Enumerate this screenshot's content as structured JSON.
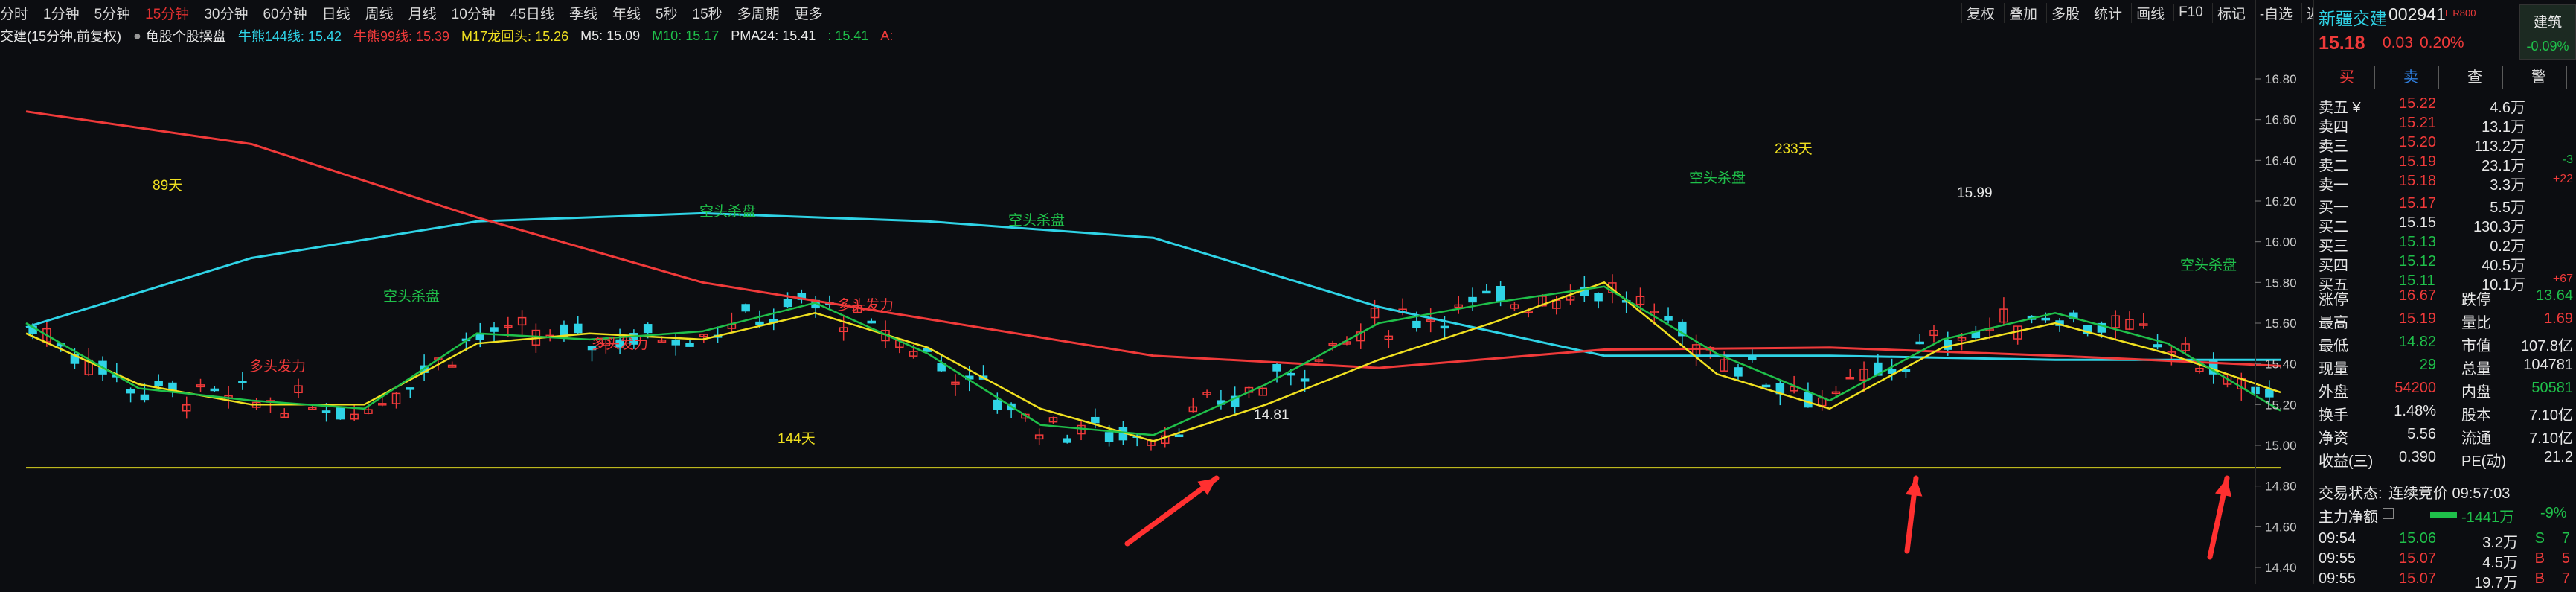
{
  "periods": [
    "分时",
    "1分钟",
    "5分钟",
    "15分钟",
    "30分钟",
    "60分钟",
    "日线",
    "周线",
    "月线",
    "10分钟",
    "45日线",
    "季线",
    "年线",
    "5秒",
    "15秒",
    "多周期",
    "更多"
  ],
  "active_period": "15分钟",
  "tools": [
    "复权",
    "叠加",
    "多股",
    "统计",
    "画线",
    "F10",
    "标记",
    "-自选",
    "返回"
  ],
  "indicator": {
    "title": "交建(15分钟,前复权)",
    "name": "龟股个股操盘",
    "items": [
      {
        "label": "牛熊144线: 15.42",
        "color": "#2fd3e6"
      },
      {
        "label": "牛熊99线: 15.39",
        "color": "#f03a3a"
      },
      {
        "label": "M17龙回头: 15.26",
        "color": "#f0e020"
      },
      {
        "label": "M5: 15.09",
        "color": "#e8e8e8"
      },
      {
        "label": "M10: 15.17",
        "color": "#1fc04a"
      },
      {
        "label": "PMA24: 15.41",
        "color": "#e8e8e8"
      },
      {
        "label": ": 15.41",
        "color": "#1fc04a"
      },
      {
        "label": "A:",
        "color": "#f03a3a"
      }
    ]
  },
  "chart_data": {
    "type": "line",
    "ylim": [
      14.4,
      16.9
    ],
    "yticks": [
      16.8,
      16.6,
      16.4,
      16.2,
      16.0,
      15.8,
      15.6,
      15.4,
      15.2,
      15.0,
      14.8,
      14.6,
      14.4
    ],
    "horizontal_line": 14.89,
    "annotations": [
      {
        "text": "89天",
        "color": "#f0e020"
      },
      {
        "text": "233天",
        "color": "#f0e020"
      },
      {
        "text": "144天",
        "color": "#f0e020"
      },
      {
        "text": "空头杀盘",
        "color": "#1fc04a"
      },
      {
        "text": "空头杀盘",
        "color": "#1fc04a"
      },
      {
        "text": "空头杀盘",
        "color": "#1fc04a"
      },
      {
        "text": "空头杀盘",
        "color": "#1fc04a"
      },
      {
        "text": "空头杀盘",
        "color": "#1fc04a"
      },
      {
        "text": "多头发力",
        "color": "#f03a3a"
      },
      {
        "text": "多头发力",
        "color": "#f03a3a"
      },
      {
        "text": "多头发力",
        "color": "#f03a3a"
      },
      {
        "text": "14.81",
        "color": "#e8e8e8"
      },
      {
        "text": "15.99",
        "color": "#e8e8e8"
      }
    ],
    "series": [
      {
        "name": "牛熊144线",
        "color": "#2fd3e6",
        "x": [
          0,
          10,
          20,
          30,
          40,
          50,
          60,
          70,
          80,
          90,
          100
        ],
        "values": [
          15.58,
          15.92,
          16.1,
          16.14,
          16.1,
          16.02,
          15.68,
          15.44,
          15.44,
          15.42,
          15.42
        ]
      },
      {
        "name": "牛熊99线",
        "color": "#f03a3a",
        "x": [
          0,
          10,
          20,
          30,
          40,
          50,
          60,
          70,
          80,
          90,
          100
        ],
        "values": [
          16.64,
          16.48,
          16.12,
          15.8,
          15.62,
          15.44,
          15.38,
          15.47,
          15.48,
          15.44,
          15.39
        ]
      },
      {
        "name": "M17龙回头",
        "color": "#f0e020",
        "x": [
          0,
          5,
          10,
          15,
          20,
          25,
          30,
          35,
          40,
          45,
          50,
          55,
          60,
          65,
          70,
          75,
          80,
          85,
          90,
          95,
          100
        ],
        "values": [
          15.55,
          15.3,
          15.2,
          15.2,
          15.5,
          15.55,
          15.52,
          15.65,
          15.48,
          15.18,
          15.02,
          15.2,
          15.42,
          15.6,
          15.8,
          15.35,
          15.18,
          15.48,
          15.6,
          15.45,
          15.26
        ]
      },
      {
        "name": "M10",
        "color": "#1fc04a",
        "x": [
          0,
          5,
          10,
          15,
          20,
          25,
          30,
          35,
          40,
          45,
          50,
          55,
          60,
          65,
          70,
          75,
          80,
          85,
          90,
          95,
          100
        ],
        "values": [
          15.6,
          15.28,
          15.22,
          15.18,
          15.55,
          15.52,
          15.56,
          15.7,
          15.45,
          15.1,
          15.05,
          15.3,
          15.6,
          15.7,
          15.78,
          15.45,
          15.22,
          15.52,
          15.65,
          15.5,
          15.17
        ]
      }
    ]
  },
  "quote": {
    "name": "新疆交建",
    "code": "002941",
    "badge": "L R800",
    "price": "15.18",
    "change": "0.03",
    "pct": "0.20%",
    "sector_name": "建筑",
    "sector_pct": "-0.09%",
    "buttons": [
      "买",
      "卖",
      "查",
      "警"
    ],
    "asks": [
      {
        "label": "卖五 ¥",
        "price": "15.22",
        "vol": "4.6万",
        "delta": ""
      },
      {
        "label": "卖四",
        "price": "15.21",
        "vol": "13.1万",
        "delta": ""
      },
      {
        "label": "卖三",
        "price": "15.20",
        "vol": "113.2万",
        "delta": ""
      },
      {
        "label": "卖二",
        "price": "15.19",
        "vol": "23.1万",
        "delta": "-3"
      },
      {
        "label": "卖一",
        "price": "15.18",
        "vol": "3.3万",
        "delta": "+22"
      }
    ],
    "bids": [
      {
        "label": "买一",
        "price": "15.17",
        "vol": "5.5万",
        "delta": "",
        "color": "#f03a3a"
      },
      {
        "label": "买二",
        "price": "15.15",
        "vol": "130.3万",
        "delta": "",
        "color": "#e8e8e8"
      },
      {
        "label": "买三",
        "price": "15.13",
        "vol": "0.2万",
        "delta": "",
        "color": "#1fc04a"
      },
      {
        "label": "买四",
        "price": "15.12",
        "vol": "40.5万",
        "delta": "",
        "color": "#1fc04a"
      },
      {
        "label": "买五",
        "price": "15.11",
        "vol": "10.1万",
        "delta": "+67",
        "color": "#1fc04a"
      }
    ],
    "stats": [
      {
        "l1": "涨停",
        "v1": "16.67",
        "c1": "#f03a3a",
        "l2": "跌停",
        "v2": "13.64",
        "c2": "#1fc04a"
      },
      {
        "l1": "最高",
        "v1": "15.19",
        "c1": "#f03a3a",
        "l2": "量比",
        "v2": "1.69",
        "c2": "#f03a3a"
      },
      {
        "l1": "最低",
        "v1": "14.82",
        "c1": "#1fc04a",
        "l2": "市值",
        "v2": "107.8亿",
        "c2": "#e8e8e8"
      },
      {
        "l1": "现量",
        "v1": "29",
        "c1": "#1fc04a",
        "l2": "总量",
        "v2": "104781",
        "c2": "#e8e8e8"
      },
      {
        "l1": "外盘",
        "v1": "54200",
        "c1": "#f03a3a",
        "l2": "内盘",
        "v2": "50581",
        "c2": "#1fc04a"
      },
      {
        "l1": "换手",
        "v1": "1.48%",
        "c1": "#e8e8e8",
        "l2": "股本",
        "v2": "7.10亿",
        "c2": "#e8e8e8"
      },
      {
        "l1": "净资",
        "v1": "5.56",
        "c1": "#e8e8e8",
        "l2": "流通",
        "v2": "7.10亿",
        "c2": "#e8e8e8"
      },
      {
        "l1": "收益(三)",
        "v1": "0.390",
        "c1": "#e8e8e8",
        "l2": "PE(动)",
        "v2": "21.2",
        "c2": "#e8e8e8"
      }
    ],
    "trade_status_label": "交易状态:",
    "trade_status": "连续竞价 09:57:03",
    "main_flow_label": "主力净额",
    "main_flow": "-1441万",
    "main_flow_pct": "-9%",
    "ticks": [
      {
        "time": "09:54",
        "price": "15.06",
        "vol": "3.2万",
        "side": "S",
        "n": "7",
        "color": "#1fc04a"
      },
      {
        "time": "09:55",
        "price": "15.07",
        "vol": "4.5万",
        "side": "B",
        "n": "5",
        "color": "#f03a3a"
      },
      {
        "time": "09:55",
        "price": "15.07",
        "vol": "19.7万",
        "side": "B",
        "n": "7",
        "color": "#f03a3a"
      }
    ]
  }
}
